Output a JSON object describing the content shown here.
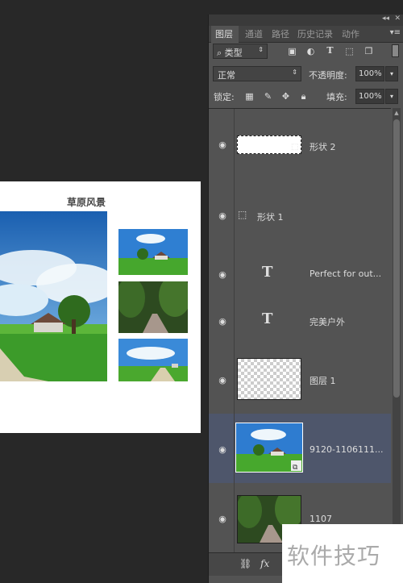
{
  "canvas": {
    "title": "草原风景"
  },
  "panel": {
    "tabs": [
      {
        "label": "图层"
      },
      {
        "label": "通道"
      },
      {
        "label": "路径"
      },
      {
        "label": "历史记录"
      },
      {
        "label": "动作"
      }
    ],
    "filter": {
      "value": "类型"
    },
    "blend_mode": "正常",
    "opacity_label": "不透明度:",
    "opacity_value": "100%",
    "lock_label": "锁定:",
    "fill_label": "填充:",
    "fill_value": "100%",
    "layers": [
      {
        "name": "形状 2"
      },
      {
        "name": "形状 1"
      },
      {
        "name": "Perfect for out..."
      },
      {
        "name": "完美户外"
      },
      {
        "name": "图层 1"
      },
      {
        "name": "9120-1106111..."
      },
      {
        "name": "1107"
      }
    ],
    "bottom_fx": "fx"
  },
  "watermark": {
    "text": "软件技巧"
  },
  "colors": {
    "panel_bg": "#535353",
    "selected_layer": "#4e566b",
    "workspace": "#282828"
  }
}
